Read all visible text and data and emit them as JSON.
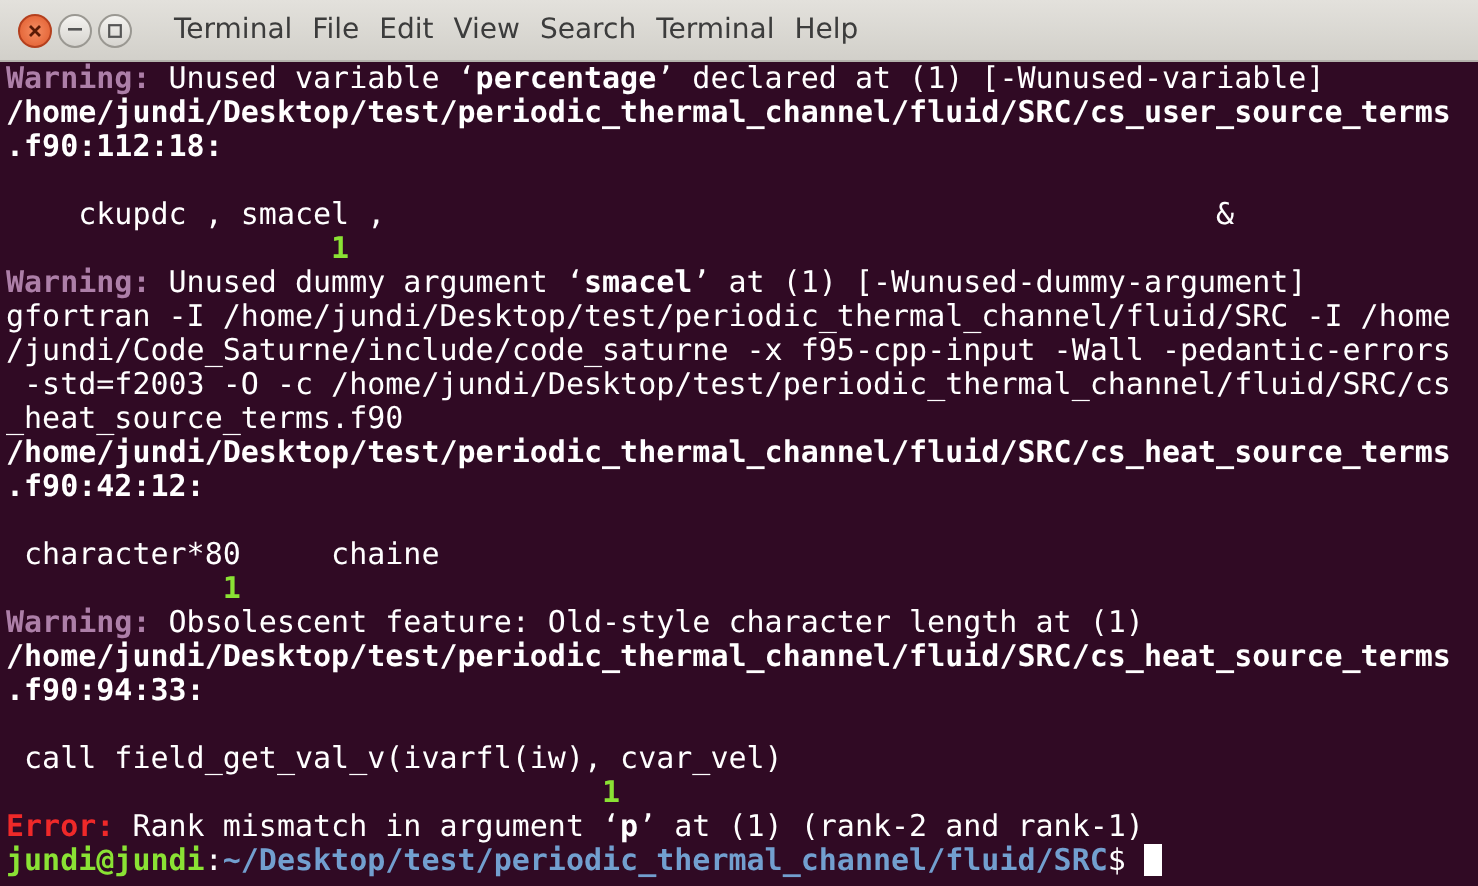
{
  "window": {
    "buttons": [
      {
        "kind": "close"
      },
      {
        "kind": "minimize"
      },
      {
        "kind": "maximize"
      }
    ]
  },
  "menu": [
    "Terminal",
    "File",
    "Edit",
    "View",
    "Search",
    "Terminal",
    "Help"
  ],
  "terminal": {
    "lines": [
      {
        "kind": "warning",
        "label": "Warning:",
        "text": "Unused variable ‘**percentage**’ declared at (1) [-Wunused-variable]"
      },
      {
        "kind": "location",
        "text": "/home/jundi/Desktop/test/periodic_thermal_channel/fluid/SRC/cs_user_source_terms"
      },
      {
        "kind": "location",
        "text": ".f90:112:18:"
      },
      {
        "kind": "blank"
      },
      {
        "kind": "source",
        "text": "    ckupdc , smacel ,                                              &"
      },
      {
        "kind": "marker",
        "text": "                  1"
      },
      {
        "kind": "warning",
        "label": "Warning:",
        "text": "Unused dummy argument ‘**smacel**’ at (1) [-Wunused-dummy-argument]"
      },
      {
        "kind": "source",
        "text": "gfortran -I /home/jundi/Desktop/test/periodic_thermal_channel/fluid/SRC -I /home"
      },
      {
        "kind": "source",
        "text": "/jundi/Code_Saturne/include/code_saturne -x f95-cpp-input -Wall -pedantic-errors"
      },
      {
        "kind": "source",
        "text": " -std=f2003 -O -c /home/jundi/Desktop/test/periodic_thermal_channel/fluid/SRC/cs"
      },
      {
        "kind": "source",
        "text": "_heat_source_terms.f90"
      },
      {
        "kind": "location",
        "text": "/home/jundi/Desktop/test/periodic_thermal_channel/fluid/SRC/cs_heat_source_terms"
      },
      {
        "kind": "location",
        "text": ".f90:42:12:"
      },
      {
        "kind": "blank"
      },
      {
        "kind": "source",
        "text": " character*80     chaine"
      },
      {
        "kind": "marker",
        "text": "            1"
      },
      {
        "kind": "warning",
        "label": "Warning:",
        "text": "Obsolescent feature: Old-style character length at (1)"
      },
      {
        "kind": "location",
        "text": "/home/jundi/Desktop/test/periodic_thermal_channel/fluid/SRC/cs_heat_source_terms"
      },
      {
        "kind": "location",
        "text": ".f90:94:33:"
      },
      {
        "kind": "blank"
      },
      {
        "kind": "source",
        "text": " call field_get_val_v(ivarfl(iw), cvar_vel)"
      },
      {
        "kind": "marker",
        "text": "                                 1"
      },
      {
        "kind": "error",
        "label": "Error:",
        "text": "Rank mismatch in argument ‘**p**’ at (1) (rank-2 and rank-1)"
      },
      {
        "kind": "prompt",
        "user": "jundi@jundi",
        "separator": ":",
        "cwd": "~/Desktop/test/periodic_thermal_channel/fluid/SRC",
        "symbol": "$"
      }
    ]
  }
}
